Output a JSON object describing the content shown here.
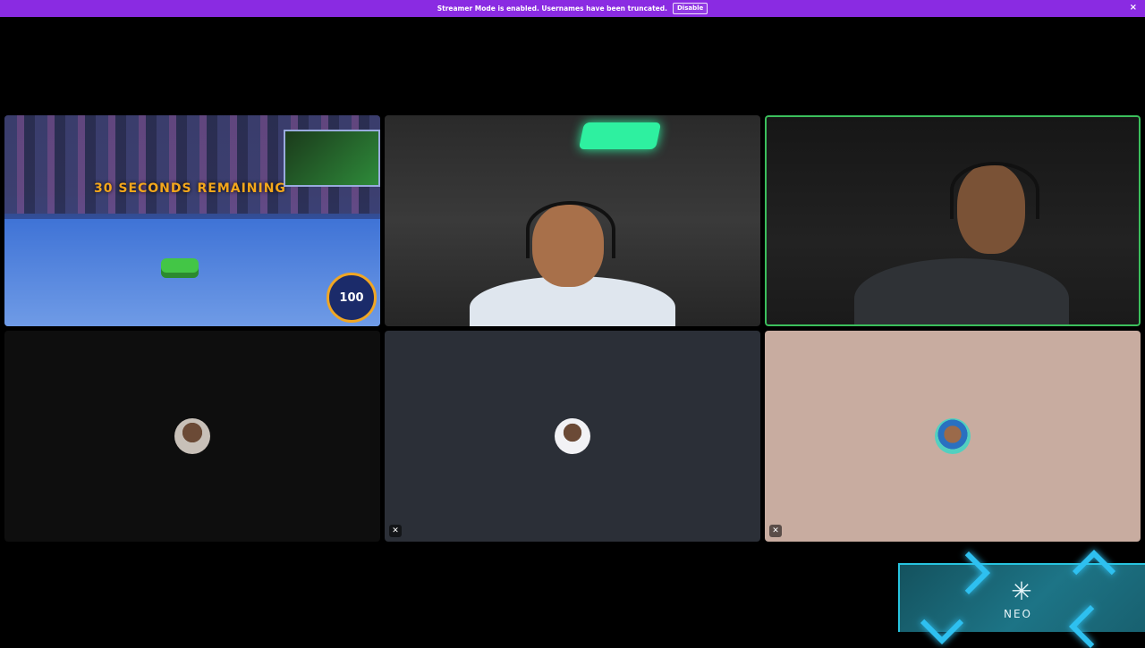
{
  "banner": {
    "message": "Streamer Mode is enabled. Usernames have been truncated.",
    "disable_label": "Disable",
    "close_icon": "×",
    "color": "#8a2be2"
  },
  "tiles": [
    {
      "kind": "screen-share",
      "speaking": false
    },
    {
      "kind": "camera",
      "speaking": false
    },
    {
      "kind": "camera",
      "speaking": true,
      "speaking_color": "#3bbf5c"
    },
    {
      "kind": "avatar",
      "muted": false
    },
    {
      "kind": "avatar",
      "muted": true
    },
    {
      "kind": "avatar",
      "muted": true
    }
  ],
  "game_overlay": {
    "timer_text": "30 SECONDS REMAINING",
    "boost_value": "100"
  },
  "muted_icon": "✕",
  "neo": {
    "mark": "✳",
    "text": "NEO"
  }
}
